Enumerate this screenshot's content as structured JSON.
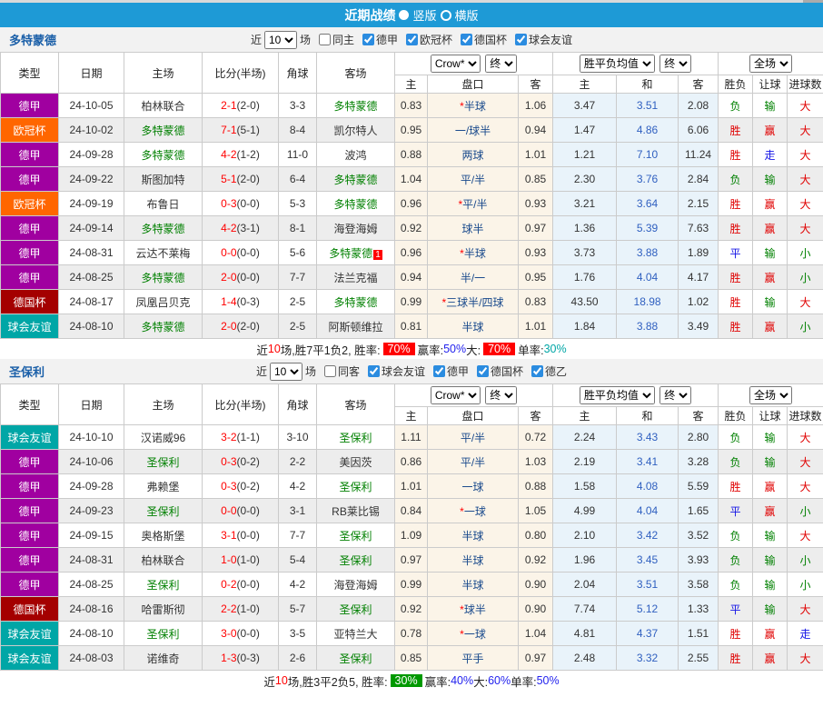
{
  "header": {
    "title": "近期战绩",
    "layout_options": [
      {
        "label": "竖版",
        "selected": true
      },
      {
        "label": "横版",
        "selected": false
      }
    ]
  },
  "filters_common": {
    "near": "近",
    "count": "10",
    "games": "场"
  },
  "columns": {
    "type": "类型",
    "date": "日期",
    "home": "主场",
    "score": "比分(半场)",
    "corner": "角球",
    "away": "客场",
    "asian_home": "主",
    "handicap": "盘口",
    "asian_away": "客",
    "euro_home": "主",
    "euro_draw": "和",
    "euro_away": "客",
    "result": "胜负",
    "handicap_result": "让球",
    "goals": "进球数",
    "odds_company": "Crow*",
    "odds_time_1": "终",
    "euro_label": "胜平负均值",
    "odds_time_2": "终",
    "scope": "全场"
  },
  "colors": {
    "title_bar": "#1E9AD6",
    "asian_cols_bg": "#FBF4E8",
    "euro_cols_bg": "#E9F3FA",
    "win_red": "#E00000",
    "lose_green": "#008000",
    "draw_blue": "#1414E6"
  },
  "league_colors": {
    "德甲": "#A000A0",
    "欧冠杯": "#FF6600",
    "德国杯": "#A40000",
    "球会友谊": "#00A6A6",
    "德乙": "#A000A0"
  },
  "result_color_map": {
    "胜": "r",
    "赢": "r",
    "大": "r",
    "平": "b",
    "走": "b",
    "负": "g",
    "输": "g",
    "小": "g"
  },
  "sections": [
    {
      "team": "多特蒙德",
      "filter": {
        "scope_label": "同主",
        "scope_checked": false,
        "leagues": [
          "德甲",
          "欧冠杯",
          "德国杯",
          "球会友谊"
        ]
      },
      "rows": [
        {
          "league": "德甲",
          "date": "24-10-05",
          "home": "柏林联合",
          "home_focus": false,
          "score": "2-1",
          "half": "(2-0)",
          "corner": "3-3",
          "away": "多特蒙德",
          "away_focus": true,
          "away_badge": "",
          "ah": "0.83",
          "handicap": "*半球",
          "aa": "1.06",
          "eh": "3.47",
          "ed": "3.51",
          "ea": "2.08",
          "result": "负",
          "spread": "输",
          "total": "大"
        },
        {
          "league": "欧冠杯",
          "date": "24-10-02",
          "home": "多特蒙德",
          "home_focus": true,
          "score": "7-1",
          "half": "(5-1)",
          "corner": "8-4",
          "away": "凯尔特人",
          "away_focus": false,
          "away_badge": "",
          "ah": "0.95",
          "handicap": "一/球半",
          "aa": "0.94",
          "eh": "1.47",
          "ed": "4.86",
          "ea": "6.06",
          "result": "胜",
          "spread": "赢",
          "total": "大"
        },
        {
          "league": "德甲",
          "date": "24-09-28",
          "home": "多特蒙德",
          "home_focus": true,
          "score": "4-2",
          "half": "(1-2)",
          "corner": "11-0",
          "away": "波鸿",
          "away_focus": false,
          "away_badge": "",
          "ah": "0.88",
          "handicap": "两球",
          "aa": "1.01",
          "eh": "1.21",
          "ed": "7.10",
          "ea": "11.24",
          "result": "胜",
          "spread": "走",
          "total": "大"
        },
        {
          "league": "德甲",
          "date": "24-09-22",
          "home": "斯图加特",
          "home_focus": false,
          "score": "5-1",
          "half": "(2-0)",
          "corner": "6-4",
          "away": "多特蒙德",
          "away_focus": true,
          "away_badge": "",
          "ah": "1.04",
          "handicap": "平/半",
          "aa": "0.85",
          "eh": "2.30",
          "ed": "3.76",
          "ea": "2.84",
          "result": "负",
          "spread": "输",
          "total": "大"
        },
        {
          "league": "欧冠杯",
          "date": "24-09-19",
          "home": "布鲁日",
          "home_focus": false,
          "score": "0-3",
          "half": "(0-0)",
          "corner": "5-3",
          "away": "多特蒙德",
          "away_focus": true,
          "away_badge": "",
          "ah": "0.96",
          "handicap": "*平/半",
          "aa": "0.93",
          "eh": "3.21",
          "ed": "3.64",
          "ea": "2.15",
          "result": "胜",
          "spread": "赢",
          "total": "大"
        },
        {
          "league": "德甲",
          "date": "24-09-14",
          "home": "多特蒙德",
          "home_focus": true,
          "score": "4-2",
          "half": "(3-1)",
          "corner": "8-1",
          "away": "海登海姆",
          "away_focus": false,
          "away_badge": "",
          "ah": "0.92",
          "handicap": "球半",
          "aa": "0.97",
          "eh": "1.36",
          "ed": "5.39",
          "ea": "7.63",
          "result": "胜",
          "spread": "赢",
          "total": "大"
        },
        {
          "league": "德甲",
          "date": "24-08-31",
          "home": "云达不莱梅",
          "home_focus": false,
          "score": "0-0",
          "half": "(0-0)",
          "corner": "5-6",
          "away": "多特蒙德",
          "away_focus": true,
          "away_badge": "1",
          "ah": "0.96",
          "handicap": "*半球",
          "aa": "0.93",
          "eh": "3.73",
          "ed": "3.88",
          "ea": "1.89",
          "result": "平",
          "spread": "输",
          "total": "小"
        },
        {
          "league": "德甲",
          "date": "24-08-25",
          "home": "多特蒙德",
          "home_focus": true,
          "score": "2-0",
          "half": "(0-0)",
          "corner": "7-7",
          "away": "法兰克福",
          "away_focus": false,
          "away_badge": "",
          "ah": "0.94",
          "handicap": "半/一",
          "aa": "0.95",
          "eh": "1.76",
          "ed": "4.04",
          "ea": "4.17",
          "result": "胜",
          "spread": "赢",
          "total": "小"
        },
        {
          "league": "德国杯",
          "date": "24-08-17",
          "home": "凤凰吕贝克",
          "home_focus": false,
          "score": "1-4",
          "half": "(0-3)",
          "corner": "2-5",
          "away": "多特蒙德",
          "away_focus": true,
          "away_badge": "",
          "ah": "0.99",
          "handicap": "*三球半/四球",
          "aa": "0.83",
          "eh": "43.50",
          "ed": "18.98",
          "ea": "1.02",
          "result": "胜",
          "spread": "输",
          "total": "大"
        },
        {
          "league": "球会友谊",
          "date": "24-08-10",
          "home": "多特蒙德",
          "home_focus": true,
          "score": "2-0",
          "half": "(2-0)",
          "corner": "2-5",
          "away": "阿斯顿维拉",
          "away_focus": false,
          "away_badge": "",
          "ah": "0.81",
          "handicap": "半球",
          "aa": "1.01",
          "eh": "1.84",
          "ed": "3.88",
          "ea": "3.49",
          "result": "胜",
          "spread": "赢",
          "total": "小"
        }
      ],
      "summary": [
        {
          "text": "近",
          "style": "plain"
        },
        {
          "text": "10",
          "style": "red"
        },
        {
          "text": "场,胜7平1负2, 胜率:",
          "style": "plain"
        },
        {
          "text": "70%",
          "style": "badge-red"
        },
        {
          "text": "赢率:",
          "style": "plain"
        },
        {
          "text": "50%",
          "style": "blue"
        },
        {
          "text": " 大:",
          "style": "plain"
        },
        {
          "text": "70%",
          "style": "badge-red"
        },
        {
          "text": "单率:",
          "style": "plain"
        },
        {
          "text": "30%",
          "style": "teal"
        }
      ]
    },
    {
      "team": "圣保利",
      "filter": {
        "scope_label": "同客",
        "scope_checked": false,
        "leagues": [
          "球会友谊",
          "德甲",
          "德国杯",
          "德乙"
        ]
      },
      "rows": [
        {
          "league": "球会友谊",
          "date": "24-10-10",
          "home": "汉诺威96",
          "home_focus": false,
          "score": "3-2",
          "half": "(1-1)",
          "corner": "3-10",
          "away": "圣保利",
          "away_focus": true,
          "away_badge": "",
          "ah": "1.11",
          "handicap": "平/半",
          "aa": "0.72",
          "eh": "2.24",
          "ed": "3.43",
          "ea": "2.80",
          "result": "负",
          "spread": "输",
          "total": "大"
        },
        {
          "league": "德甲",
          "date": "24-10-06",
          "home": "圣保利",
          "home_focus": true,
          "score": "0-3",
          "half": "(0-2)",
          "corner": "2-2",
          "away": "美因茨",
          "away_focus": false,
          "away_badge": "",
          "ah": "0.86",
          "handicap": "平/半",
          "aa": "1.03",
          "eh": "2.19",
          "ed": "3.41",
          "ea": "3.28",
          "result": "负",
          "spread": "输",
          "total": "大"
        },
        {
          "league": "德甲",
          "date": "24-09-28",
          "home": "弗赖堡",
          "home_focus": false,
          "score": "0-3",
          "half": "(0-2)",
          "corner": "4-2",
          "away": "圣保利",
          "away_focus": true,
          "away_badge": "",
          "ah": "1.01",
          "handicap": "一球",
          "aa": "0.88",
          "eh": "1.58",
          "ed": "4.08",
          "ea": "5.59",
          "result": "胜",
          "spread": "赢",
          "total": "大"
        },
        {
          "league": "德甲",
          "date": "24-09-23",
          "home": "圣保利",
          "home_focus": true,
          "score": "0-0",
          "half": "(0-0)",
          "corner": "3-1",
          "away": "RB莱比锡",
          "away_focus": false,
          "away_badge": "",
          "ah": "0.84",
          "handicap": "*一球",
          "aa": "1.05",
          "eh": "4.99",
          "ed": "4.04",
          "ea": "1.65",
          "result": "平",
          "spread": "赢",
          "total": "小"
        },
        {
          "league": "德甲",
          "date": "24-09-15",
          "home": "奥格斯堡",
          "home_focus": false,
          "score": "3-1",
          "half": "(0-0)",
          "corner": "7-7",
          "away": "圣保利",
          "away_focus": true,
          "away_badge": "",
          "ah": "1.09",
          "handicap": "半球",
          "aa": "0.80",
          "eh": "2.10",
          "ed": "3.42",
          "ea": "3.52",
          "result": "负",
          "spread": "输",
          "total": "大"
        },
        {
          "league": "德甲",
          "date": "24-08-31",
          "home": "柏林联合",
          "home_focus": false,
          "score": "1-0",
          "half": "(1-0)",
          "corner": "5-4",
          "away": "圣保利",
          "away_focus": true,
          "away_badge": "",
          "ah": "0.97",
          "handicap": "半球",
          "aa": "0.92",
          "eh": "1.96",
          "ed": "3.45",
          "ea": "3.93",
          "result": "负",
          "spread": "输",
          "total": "小"
        },
        {
          "league": "德甲",
          "date": "24-08-25",
          "home": "圣保利",
          "home_focus": true,
          "score": "0-2",
          "half": "(0-0)",
          "corner": "4-2",
          "away": "海登海姆",
          "away_focus": false,
          "away_badge": "",
          "ah": "0.99",
          "handicap": "半球",
          "aa": "0.90",
          "eh": "2.04",
          "ed": "3.51",
          "ea": "3.58",
          "result": "负",
          "spread": "输",
          "total": "小"
        },
        {
          "league": "德国杯",
          "date": "24-08-16",
          "home": "哈雷斯彻",
          "home_focus": false,
          "score": "2-2",
          "half": "(1-0)",
          "corner": "5-7",
          "away": "圣保利",
          "away_focus": true,
          "away_badge": "",
          "ah": "0.92",
          "handicap": "*球半",
          "aa": "0.90",
          "eh": "7.74",
          "ed": "5.12",
          "ea": "1.33",
          "result": "平",
          "spread": "输",
          "total": "大"
        },
        {
          "league": "球会友谊",
          "date": "24-08-10",
          "home": "圣保利",
          "home_focus": true,
          "score": "3-0",
          "half": "(0-0)",
          "corner": "3-5",
          "away": "亚特兰大",
          "away_focus": false,
          "away_badge": "",
          "ah": "0.78",
          "handicap": "*一球",
          "aa": "1.04",
          "eh": "4.81",
          "ed": "4.37",
          "ea": "1.51",
          "result": "胜",
          "spread": "赢",
          "total": "走"
        },
        {
          "league": "球会友谊",
          "date": "24-08-03",
          "home": "诺维奇",
          "home_focus": false,
          "score": "1-3",
          "half": "(0-3)",
          "corner": "2-6",
          "away": "圣保利",
          "away_focus": true,
          "away_badge": "",
          "ah": "0.85",
          "handicap": "平手",
          "aa": "0.97",
          "eh": "2.48",
          "ed": "3.32",
          "ea": "2.55",
          "result": "胜",
          "spread": "赢",
          "total": "大"
        }
      ],
      "summary": [
        {
          "text": "近",
          "style": "plain"
        },
        {
          "text": "10",
          "style": "red"
        },
        {
          "text": "场,胜3平2负5, 胜率:",
          "style": "plain"
        },
        {
          "text": "30%",
          "style": "badge-green"
        },
        {
          "text": "赢率:",
          "style": "plain"
        },
        {
          "text": "40%",
          "style": "blue"
        },
        {
          "text": " 大:",
          "style": "plain"
        },
        {
          "text": "60%",
          "style": "blue"
        },
        {
          "text": " 单率:",
          "style": "plain"
        },
        {
          "text": "50%",
          "style": "blue"
        }
      ]
    }
  ]
}
